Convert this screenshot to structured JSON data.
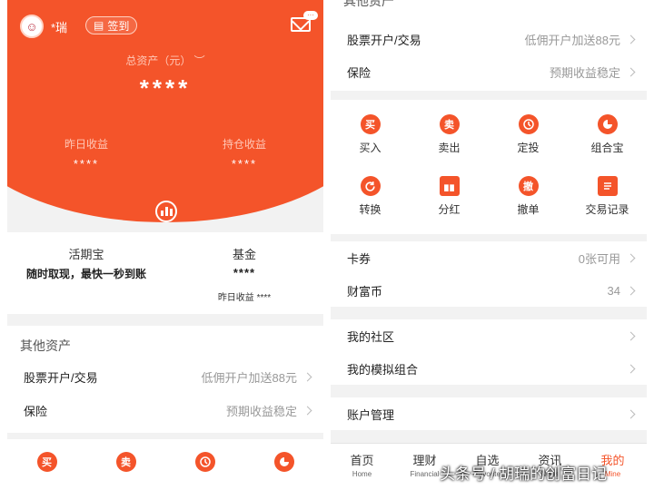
{
  "left": {
    "header": {
      "username": "*瑞",
      "signin_label": "签到",
      "mail_badge": "···",
      "total_label": "总资产（元）",
      "total_value": "****",
      "yesterday_label": "昨日收益",
      "yesterday_value": "****",
      "holding_label": "持仓收益",
      "holding_value": "****"
    },
    "products": {
      "huoqibao_title": "活期宝",
      "huoqibao_desc": "随时取现，最快一秒到账",
      "fund_title": "基金",
      "fund_value": "****",
      "fund_yesterday": "昨日收益 ****"
    },
    "other_assets": {
      "heading": "其他资产",
      "rows": [
        {
          "label": "股票开户/交易",
          "value": "低佣开户加送88元"
        },
        {
          "label": "保险",
          "value": "预期收益稳定"
        }
      ]
    },
    "bottom_icons": [
      "买",
      "卖",
      "clock",
      "pie"
    ]
  },
  "right": {
    "partial_heading": "其他资产",
    "top_rows": [
      {
        "label": "股票开户/交易",
        "value": "低佣开户加送88元"
      },
      {
        "label": "保险",
        "value": "预期收益稳定"
      }
    ],
    "grid": [
      {
        "label": "买入",
        "glyph": "买"
      },
      {
        "label": "卖出",
        "glyph": "卖"
      },
      {
        "label": "定投",
        "glyph": "clock"
      },
      {
        "label": "组合宝",
        "glyph": "pie"
      },
      {
        "label": "转换",
        "glyph": "refresh"
      },
      {
        "label": "分红",
        "glyph": "gift"
      },
      {
        "label": "撤单",
        "glyph": "撤"
      },
      {
        "label": "交易记录",
        "glyph": "list"
      }
    ],
    "rows2": [
      {
        "label": "卡券",
        "value": "0张可用"
      },
      {
        "label": "财富币",
        "value": "34"
      }
    ],
    "rows3": [
      {
        "label": "我的社区",
        "value": ""
      },
      {
        "label": "我的模拟组合",
        "value": ""
      }
    ],
    "rows4": [
      {
        "label": "账户管理",
        "value": ""
      }
    ],
    "tabs": [
      {
        "label": "首页",
        "en": "Home"
      },
      {
        "label": "理财",
        "en": "Financial"
      },
      {
        "label": "自选",
        "en": "Favorite"
      },
      {
        "label": "资讯",
        "en": "News"
      },
      {
        "label": "我的",
        "en": "Mine"
      }
    ],
    "accent": "#f4542a"
  },
  "watermark": "头条号 / 胡瑞的创富日记"
}
